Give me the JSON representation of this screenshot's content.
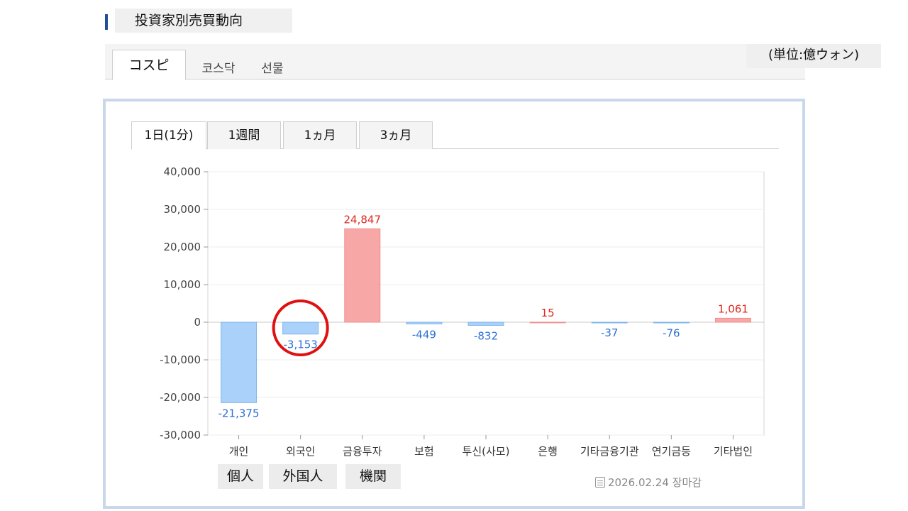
{
  "header": {
    "title": "投資家別売買動向"
  },
  "market_tabs": [
    {
      "label": "コスピ",
      "active": true
    },
    {
      "label": "코스닥",
      "active": false
    },
    {
      "label": "선물",
      "active": false
    }
  ],
  "unit": "(単位:億ウォン)",
  "period_tabs": [
    {
      "label": "1日(1分)",
      "active": true
    },
    {
      "label": "1週間",
      "active": false
    },
    {
      "label": "1ヵ月",
      "active": false
    },
    {
      "label": "3ヵ月",
      "active": false
    }
  ],
  "colors": {
    "positive": "#f8a7a7",
    "positive_border": "#ee8f8f",
    "negative": "#a9d1fa",
    "negative_border": "#7fb4ea",
    "positive_text": "#e0261f",
    "negative_text": "#2b6fd6",
    "highlight_circle": "#e01010"
  },
  "chart_data": {
    "type": "bar",
    "categories": [
      "개인",
      "외국인",
      "금융투자",
      "보험",
      "투신(사모)",
      "은행",
      "기타금융기관",
      "연기금등",
      "기타법인"
    ],
    "values": [
      -21375,
      -3153,
      24847,
      -449,
      -832,
      15,
      -37,
      -76,
      1061
    ],
    "value_labels": [
      "-21,375",
      "-3,153",
      "24,847",
      "-449",
      "-832",
      "15",
      "-37",
      "-76",
      "1,061"
    ],
    "ylim": [
      -30000,
      40000
    ],
    "yticks": [
      40000,
      30000,
      20000,
      10000,
      0,
      -10000,
      -20000,
      -30000
    ],
    "ytick_labels": [
      "40,000",
      "30,000",
      "20,000",
      "10,000",
      "0",
      "-10,000",
      "-20,000",
      "-30,000"
    ],
    "grid": true,
    "highlighted_category": "외국인"
  },
  "annotations": {
    "kanji_labels": [
      "個人",
      "外国人",
      "機関"
    ]
  },
  "footer": {
    "date": "2026.02.24 장마감"
  }
}
